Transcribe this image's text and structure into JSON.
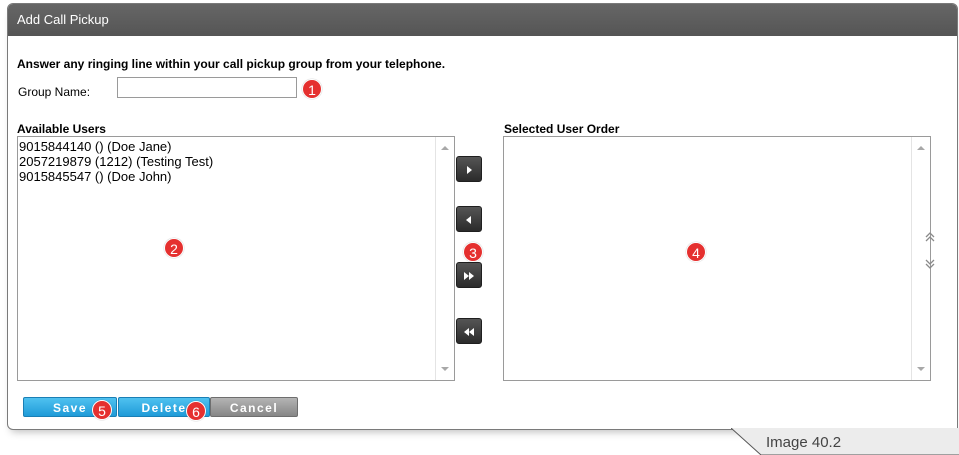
{
  "dialog": {
    "title": "Add Call Pickup",
    "description": "Answer any ringing line within your call pickup group from your telephone.",
    "group_name_label": "Group Name:",
    "group_name_value": "",
    "available_label": "Available Users",
    "selected_label": "Selected User Order",
    "available_users": [
      "9015844140 () (Doe Jane)",
      "2057219879 (1212) (Testing Test)",
      "9015845547 () (Doe John)"
    ],
    "selected_users": [],
    "move_buttons": [
      "move-right-icon",
      "move-left-icon",
      "move-all-right-icon",
      "move-all-left-icon"
    ],
    "order_buttons": [
      "move-up-icon",
      "move-down-icon"
    ],
    "buttons": {
      "save": "Save",
      "delete": "Delete",
      "cancel": "Cancel"
    }
  },
  "badges": [
    "1",
    "2",
    "3",
    "4",
    "5",
    "6"
  ],
  "caption": "Image 40.2",
  "colors": {
    "titlebar": "#5a5a5a",
    "badge": "#e5302f",
    "button_blue": "#29a8e3",
    "button_gray": "#9a9a9a",
    "move_button": "#3a3a3a"
  }
}
